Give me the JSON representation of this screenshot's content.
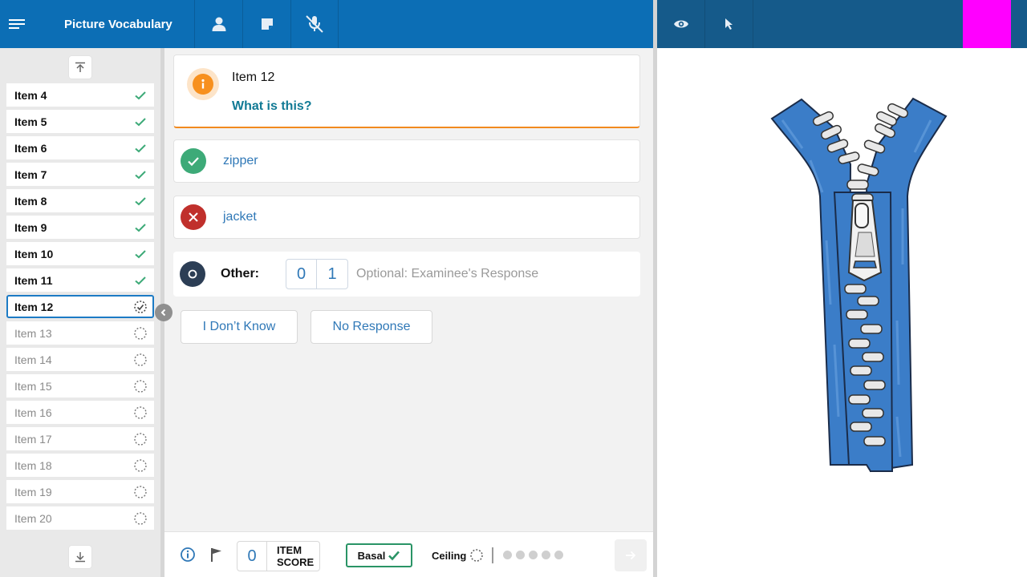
{
  "header": {
    "title": "Picture Vocabulary",
    "icons": [
      "menu-icon",
      "examinee-icon",
      "notes-icon",
      "mic-off-icon"
    ]
  },
  "right_header": {
    "icons": [
      "eye-icon",
      "pointer-icon"
    ],
    "marker_color": "#ff00ff"
  },
  "sidebar": {
    "items": [
      {
        "label": "Item 4",
        "status": "done"
      },
      {
        "label": "Item 5",
        "status": "done"
      },
      {
        "label": "Item 6",
        "status": "done"
      },
      {
        "label": "Item 7",
        "status": "done"
      },
      {
        "label": "Item 8",
        "status": "done"
      },
      {
        "label": "Item 9",
        "status": "done"
      },
      {
        "label": "Item 10",
        "status": "done"
      },
      {
        "label": "Item 11",
        "status": "done"
      },
      {
        "label": "Item 12",
        "status": "current"
      },
      {
        "label": "Item 13",
        "status": "pending"
      },
      {
        "label": "Item 14",
        "status": "pending"
      },
      {
        "label": "Item 15",
        "status": "pending"
      },
      {
        "label": "Item 16",
        "status": "pending"
      },
      {
        "label": "Item 17",
        "status": "pending"
      },
      {
        "label": "Item 18",
        "status": "pending"
      },
      {
        "label": "Item 19",
        "status": "pending"
      },
      {
        "label": "Item 20",
        "status": "pending"
      }
    ]
  },
  "item": {
    "title": "Item 12",
    "question": "What is this?"
  },
  "answers": {
    "correct": "zipper",
    "incorrect": "jacket"
  },
  "other": {
    "label": "Other:",
    "score_0": "0",
    "score_1": "1",
    "placeholder": "Optional: Examinee's Response"
  },
  "buttons": {
    "dont_know": "I Don’t Know",
    "no_response": "No Response"
  },
  "footer": {
    "item_score": "0",
    "item_score_label_1": "ITEM",
    "item_score_label_2": "SCORE",
    "basal": "Basal",
    "ceiling": "Ceiling",
    "ceiling_dots": 5
  },
  "colors": {
    "primary": "#0c6eb5",
    "correct": "#3daa78",
    "incorrect": "#c0302c",
    "accent": "#f7901e",
    "zipper_blue": "#3b7dc8"
  }
}
